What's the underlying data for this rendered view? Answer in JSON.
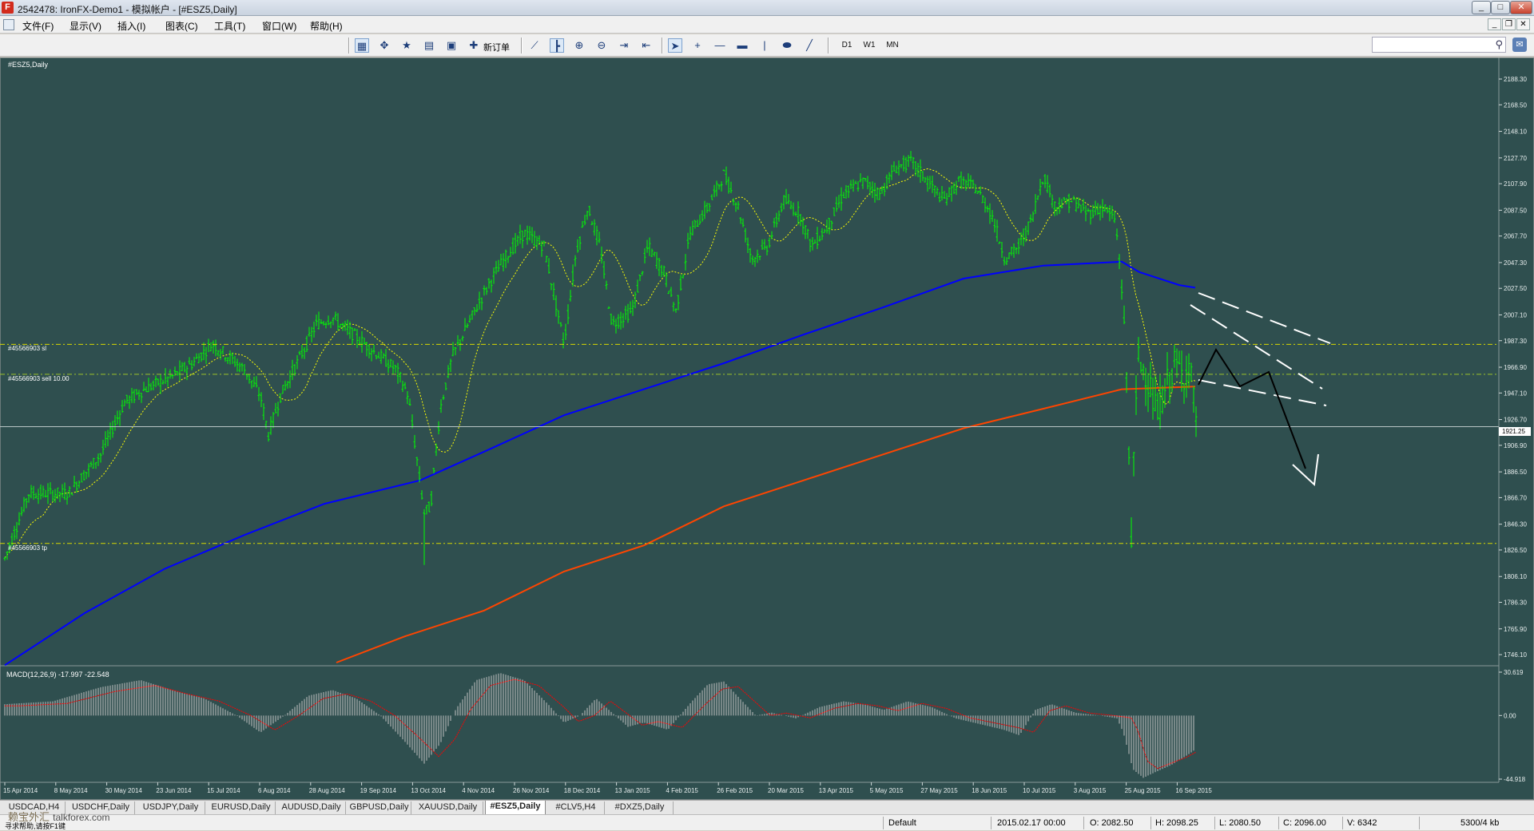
{
  "window": {
    "title": "2542478: IronFX-Demo1 - 模拟帐户 - [#ESZ5,Daily]",
    "app_icon_letter": "F",
    "controls": {
      "minimize": "_",
      "maximize": "□",
      "close": "✕"
    }
  },
  "menu": {
    "items": [
      "文件(F)",
      "显示(V)",
      "插入(I)",
      "图表(C)",
      "工具(T)",
      "窗口(W)",
      "帮助(H)"
    ],
    "mdi_controls": [
      "_",
      "❐",
      "✕"
    ]
  },
  "toolbar": {
    "new_order_label": "新订单",
    "timeframes": [
      "D1",
      "W1",
      "MN"
    ],
    "search_placeholder": ""
  },
  "chart": {
    "symbol_label": "#ESZ5,Daily",
    "indicator_label": "MACD(12,26,9) -17.997 -22.548",
    "order_lines": {
      "sl_label": "#45566903 sl",
      "entry_label": "#45566903 sell 10.00",
      "tp_label": "#45566903 tp"
    },
    "current_price_label": "1921.25",
    "price_axis": [
      "2188.30",
      "2168.50",
      "2148.10",
      "2127.70",
      "2107.90",
      "2087.50",
      "2067.70",
      "2047.30",
      "2027.50",
      "2007.10",
      "1987.30",
      "1966.90",
      "1947.10",
      "1926.70",
      "1906.90",
      "1886.50",
      "1866.70",
      "1846.30",
      "1826.50",
      "1806.10",
      "1786.30",
      "1765.90",
      "1746.10"
    ],
    "macd_axis": [
      "30.619",
      "0.00",
      "-44.918"
    ],
    "date_axis": [
      "15 Apr 2014",
      "8 May 2014",
      "30 May 2014",
      "23 Jun 2014",
      "15 Jul 2014",
      "6 Aug 2014",
      "28 Aug 2014",
      "19 Sep 2014",
      "13 Oct 2014",
      "4 Nov 2014",
      "26 Nov 2014",
      "18 Dec 2014",
      "13 Jan 2015",
      "4 Feb 2015",
      "26 Feb 2015",
      "20 Mar 2015",
      "13 Apr 2015",
      "5 May 2015",
      "27 May 2015",
      "18 Jun 2015",
      "10 Jul 2015",
      "3 Aug 2015",
      "25 Aug 2015",
      "16 Sep 2015"
    ],
    "colors": {
      "background": "#2f4f4f",
      "bars": "#00ff00",
      "ma_fast": "#ffff00",
      "ma_mid": "#0000ff",
      "ma_slow": "#ff4500",
      "order_line": "#d8d800",
      "macd_hist": "#c0c0c0",
      "macd_signal": "#ff0000",
      "projection_white": "#ffffff",
      "projection_black": "#000000"
    }
  },
  "tabs": [
    {
      "label": "USDCAD,H4",
      "active": false
    },
    {
      "label": "USDCHF,Daily",
      "active": false
    },
    {
      "label": "USDJPY,Daily",
      "active": false
    },
    {
      "label": "EURUSD,Daily",
      "active": false
    },
    {
      "label": "AUDUSD,Daily",
      "active": false
    },
    {
      "label": "GBPUSD,Daily",
      "active": false
    },
    {
      "label": "XAUUSD,Daily",
      "active": false
    },
    {
      "label": "#ESZ5,Daily",
      "active": true
    },
    {
      "label": "#CLV5,H4",
      "active": false
    },
    {
      "label": "#DXZ5,Daily",
      "active": false
    }
  ],
  "status": {
    "profile": "Default",
    "datetime": "2015.02.17 00:00",
    "open": "O: 2082.50",
    "high": "H: 2098.25",
    "low": "L: 2080.50",
    "close": "C: 2096.00",
    "volume": "V: 6342",
    "traffic": "5300/4 kb",
    "help_hint": "寻求帮助,请按F1键"
  },
  "watermark": {
    "cn": "赖宝外汇",
    "en": "talkforex.com"
  }
}
